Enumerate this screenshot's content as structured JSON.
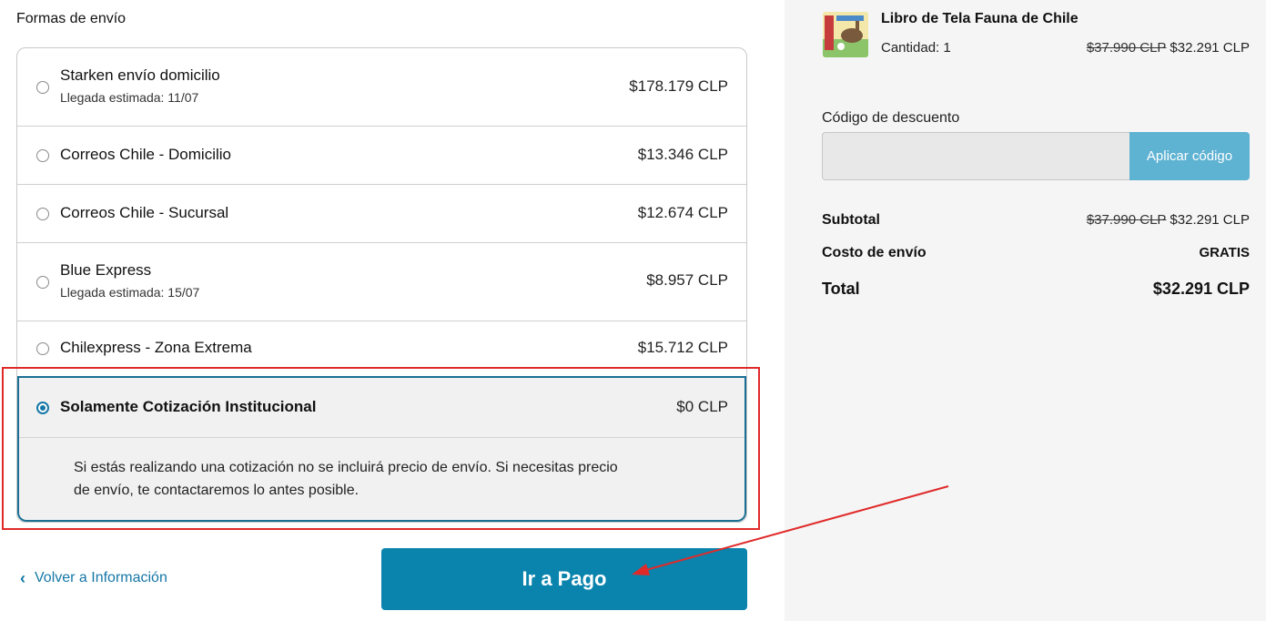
{
  "shipping": {
    "title": "Formas de envío",
    "options": [
      {
        "name": "Starken envío domicilio",
        "eta": "Llegada estimada: 11/07",
        "price": "$178.179 CLP"
      },
      {
        "name": "Correos Chile - Domicilio",
        "eta": "",
        "price": "$13.346 CLP"
      },
      {
        "name": "Correos Chile - Sucursal",
        "eta": "",
        "price": "$12.674 CLP"
      },
      {
        "name": "Blue Express",
        "eta": "Llegada estimada: 15/07",
        "price": "$8.957 CLP"
      },
      {
        "name": "Chilexpress - Zona Extrema",
        "eta": "",
        "price": "$15.712 CLP"
      }
    ],
    "selected": {
      "name": "Solamente Cotización Institucional",
      "price": "$0 CLP",
      "description_line1": "Si estás realizando una cotización no se incluirá precio de envío. Si necesitas precio",
      "description_line2": "de envío, te contactaremos lo antes posible."
    }
  },
  "nav": {
    "back_label": "Volver a Información",
    "back_icon": "chevron-left-icon",
    "pay_label": "Ir a Pago"
  },
  "summary": {
    "product_name": "Libro de Tela Fauna de Chile",
    "quantity": "Cantidad: 1",
    "old_price": "$37.990 CLP",
    "new_price": "$32.291 CLP",
    "discount_label": "Código de descuento",
    "discount_value": "",
    "apply_label": "Aplicar código",
    "subtotal_label": "Subtotal",
    "subtotal_old": "$37.990 CLP",
    "subtotal_new": "$32.291 CLP",
    "shipping_label": "Costo de envío",
    "shipping_value": "GRATIS",
    "total_label": "Total",
    "total_value": "$32.291 CLP"
  },
  "colors": {
    "accent": "#0a84ad",
    "selected_border": "#1b6f94",
    "annotation": "#e02a2a",
    "apply_button": "#5eb2d2"
  }
}
